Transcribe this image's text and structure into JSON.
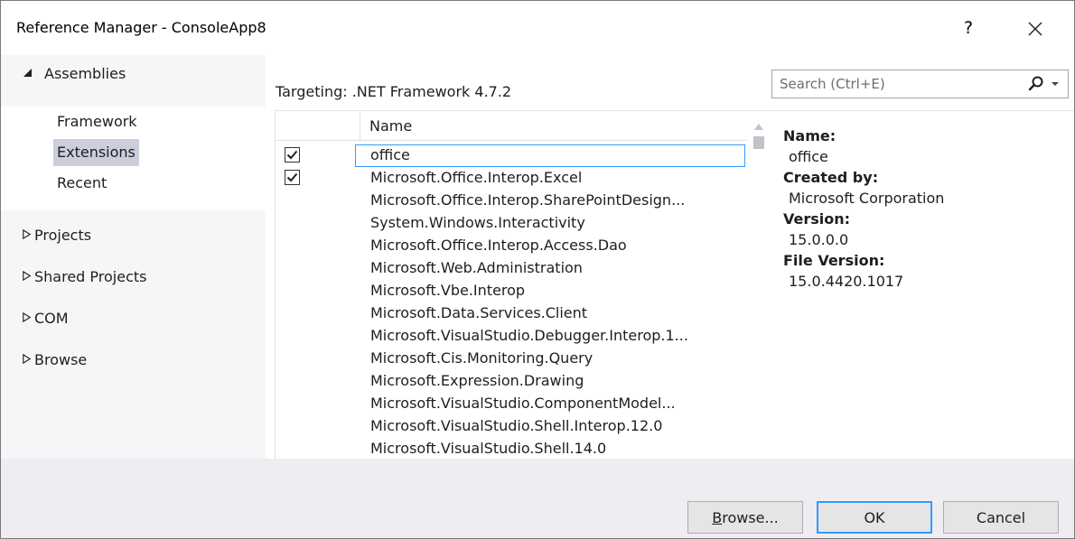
{
  "window": {
    "title": "Reference Manager - ConsoleApp8",
    "help_label": "?",
    "close_icon": "close-icon"
  },
  "sidebar": {
    "assemblies_label": "Assemblies",
    "assemblies_items": [
      {
        "label": "Framework"
      },
      {
        "label": "Extensions",
        "selected": true
      },
      {
        "label": "Recent"
      }
    ],
    "collapsed_groups": [
      {
        "label": "Projects"
      },
      {
        "label": "Shared Projects"
      },
      {
        "label": "COM"
      },
      {
        "label": "Browse"
      }
    ]
  },
  "main": {
    "targeting": "Targeting: .NET Framework 4.7.2",
    "search": {
      "placeholder": "Search (Ctrl+E)",
      "value": ""
    },
    "list": {
      "name_header": "Name",
      "rows": [
        {
          "name": "office",
          "checked": true,
          "selected": true
        },
        {
          "name": "Microsoft.Office.Interop.Excel",
          "checked": true
        },
        {
          "name": "Microsoft.Office.Interop.SharePointDesign...",
          "checked": false
        },
        {
          "name": "System.Windows.Interactivity",
          "checked": false
        },
        {
          "name": "Microsoft.Office.Interop.Access.Dao",
          "checked": false
        },
        {
          "name": "Microsoft.Web.Administration",
          "checked": false
        },
        {
          "name": "Microsoft.Vbe.Interop",
          "checked": false
        },
        {
          "name": "Microsoft.Data.Services.Client",
          "checked": false
        },
        {
          "name": "Microsoft.VisualStudio.Debugger.Interop.1...",
          "checked": false
        },
        {
          "name": "Microsoft.Cis.Monitoring.Query",
          "checked": false
        },
        {
          "name": "Microsoft.Expression.Drawing",
          "checked": false
        },
        {
          "name": "Microsoft.VisualStudio.ComponentModel...",
          "checked": false
        },
        {
          "name": "Microsoft.VisualStudio.Shell.Interop.12.0",
          "checked": false
        },
        {
          "name": "Microsoft.VisualStudio.Shell.14.0",
          "checked": false
        }
      ]
    }
  },
  "details": {
    "name_label": "Name:",
    "name_value": "office",
    "created_by_label": "Created by:",
    "created_by_value": "Microsoft Corporation",
    "version_label": "Version:",
    "version_value": "15.0.0.0",
    "file_version_label": "File Version:",
    "file_version_value": "15.0.4420.1017"
  },
  "footer": {
    "browse_label": "Browse...",
    "ok_label": "OK",
    "cancel_label": "Cancel"
  },
  "colors": {
    "selection_border": "#3399ff",
    "selected_nav_bg": "#cccedb",
    "footer_bg": "#eeeef2",
    "nav_bg": "#f5f6f7"
  }
}
